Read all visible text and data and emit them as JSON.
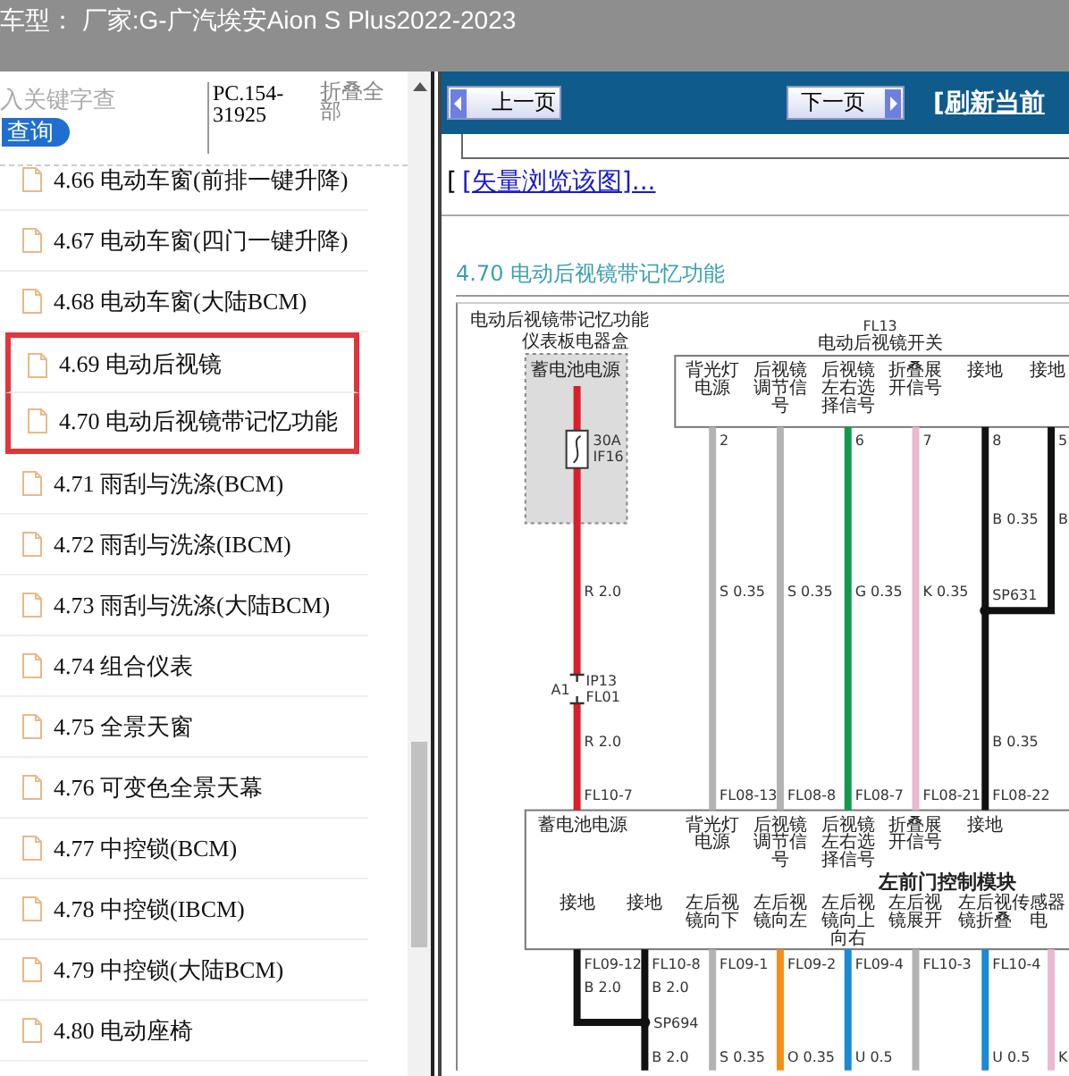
{
  "header": {
    "title": "车型： 厂家:G-广汽埃安Aion S Plus2022-2023"
  },
  "sidebar": {
    "search": {
      "placeholder": "入关键字查"
    },
    "search_button": "查询",
    "code": "PC.154-31925",
    "collapse_link": "折叠全部",
    "items": [
      {
        "label": "4.66 电动车窗(前排一键升降)",
        "highlighted": false
      },
      {
        "label": "4.67 电动车窗(四门一键升降)",
        "highlighted": false
      },
      {
        "label": "4.68 电动车窗(大陆BCM)",
        "highlighted": false
      },
      {
        "label": "4.69 电动后视镜",
        "highlighted": true
      },
      {
        "label": "4.70 电动后视镜带记忆功能",
        "highlighted": true
      },
      {
        "label": "4.71 雨刮与洗涤(BCM)",
        "highlighted": false
      },
      {
        "label": "4.72 雨刮与洗涤(IBCM)",
        "highlighted": false
      },
      {
        "label": "4.73 雨刮与洗涤(大陆BCM)",
        "highlighted": false
      },
      {
        "label": "4.74 组合仪表",
        "highlighted": false
      },
      {
        "label": "4.75 全景天窗",
        "highlighted": false
      },
      {
        "label": "4.76 可变色全景天幕",
        "highlighted": false
      },
      {
        "label": "4.77 中控锁(BCM)",
        "highlighted": false
      },
      {
        "label": "4.78 中控锁(IBCM)",
        "highlighted": false
      },
      {
        "label": "4.79 中控锁(大陆BCM)",
        "highlighted": false
      },
      {
        "label": "4.80 电动座椅",
        "highlighted": false
      }
    ]
  },
  "toolbar": {
    "prev_button": "上一页",
    "next_button": "下一页",
    "refresh_link": "[刷新当前"
  },
  "vector_link": {
    "bracket": "[",
    "label": "[矢量浏览该图]..."
  },
  "section_title": "4.70 电动后视镜带记忆功能",
  "diagram": {
    "title": "电动后视镜带记忆功能",
    "fuse_box_label": "仪表板电器盒",
    "fuse_box_source": "蓄电池电源",
    "fuse": [
      "30A",
      "IF16"
    ],
    "switch_id": "FL13",
    "switch_name": "电动后视镜开关",
    "module_name": "左前门控制模块",
    "module_top_labels": [
      "蓄电池电源",
      "背光灯电源",
      "后视镜调节信号",
      "后视镜左右选择信号",
      "折叠展开信号",
      "接地"
    ],
    "module_bottom_labels": [
      "接地",
      "接地",
      "左后视镜向下",
      "左后视镜向左",
      "左后视镜向上向右",
      "左后视镜展开",
      "左后视镜折叠",
      "传感器电"
    ],
    "upper_wires": [
      {
        "kind": "power",
        "color": "#d7202b",
        "gauges": [
          "R 2.0",
          "R 2.0"
        ],
        "connector": [
          "A1",
          "IP13",
          "FL01"
        ],
        "end": "FL10-7"
      },
      {
        "kind": "switch",
        "color": "#b3b3b3",
        "label": "背光灯电源",
        "pin": "2",
        "gauges": [
          "S 0.35"
        ],
        "end": "FL08-13"
      },
      {
        "kind": "switch",
        "color": "#b3b3b3",
        "label": "后视镜调节信号",
        "gauges": [
          "S 0.35"
        ],
        "end": "FL08-8"
      },
      {
        "kind": "switch",
        "color": "#13994a",
        "label": "后视镜左右选择信号",
        "pin": "6",
        "gauges": [
          "G 0.35"
        ],
        "end": "FL08-7"
      },
      {
        "kind": "switch",
        "color": "#eab8d0",
        "label": "折叠展开信号",
        "pin": "7",
        "gauges": [
          "K 0.35"
        ],
        "end": "FL08-21"
      },
      {
        "kind": "ground",
        "color": "#111111",
        "label": "接地",
        "pin": "8",
        "gauges": [
          "B 0.35",
          "B 0.35"
        ],
        "splice": "SP631",
        "end": "FL08-22"
      },
      {
        "kind": "ground_join",
        "color": "#111111",
        "label": "接地",
        "pin": "5",
        "gauges": [
          "B"
        ]
      }
    ],
    "lower_wires": [
      {
        "kind": "ground_join",
        "color": "#111111",
        "terminal": "FL09-12",
        "gauges": [
          "B 2.0"
        ]
      },
      {
        "kind": "ground_splice",
        "color": "#111111",
        "terminal": "FL10-8",
        "gauges": [
          "B 2.0",
          "B 2.0"
        ],
        "splice": "SP694"
      },
      {
        "kind": "signal",
        "color": "#b3b3b3",
        "terminal": "FL09-1",
        "gauges": [
          "S 0.35"
        ]
      },
      {
        "kind": "signal",
        "color": "#f39019",
        "terminal": "FL09-2",
        "gauges": [
          "O 0.35"
        ]
      },
      {
        "kind": "signal",
        "color": "#1a8ad4",
        "terminal": "FL09-4",
        "gauges": [
          "U 0.5"
        ]
      },
      {
        "kind": "signal",
        "color": "#b3b3b3",
        "terminal": "FL10-3"
      },
      {
        "kind": "signal",
        "color": "#1a8ad4",
        "terminal": "FL10-4",
        "gauges": [
          "U 0.5"
        ]
      },
      {
        "kind": "signal",
        "color": "#eab8d0",
        "gauges": [
          "K"
        ]
      }
    ]
  }
}
